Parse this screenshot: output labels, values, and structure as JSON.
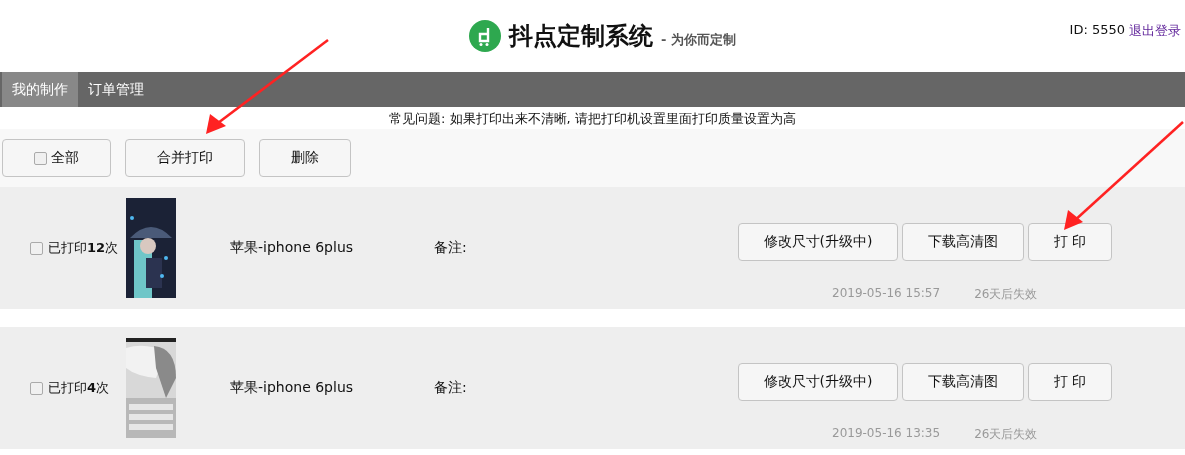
{
  "header": {
    "title": "抖点定制系统",
    "slogan": "- 为你而定制",
    "user_id": "ID: 5550",
    "logout": "退出登录"
  },
  "nav": [
    {
      "label": "我的制作",
      "selected": true
    },
    {
      "label": "订单管理",
      "selected": false
    }
  ],
  "notice": "常见问题: 如果打印出来不清晰, 请把打印机设置里面打印质量设置为高",
  "toolbar": {
    "select_all": {
      "label": "全部",
      "checked": false
    },
    "buttons": [
      "合并打印",
      "删除"
    ]
  },
  "orders": [
    {
      "checked": false,
      "printed": "已打印**12**次",
      "model": "苹果-iphone 6plus",
      "note": "备注:",
      "buttons": [
        "修改尺寸(升级中)",
        "下载高清图",
        "打 印"
      ],
      "date": "2019-05-16 15:57",
      "expiry": "26天后失效"
    },
    {
      "checked": false,
      "printed": "已打印**4**次",
      "model": "苹果-iphone 6plus",
      "note": "备注:",
      "buttons": [
        "修改尺寸(升级中)",
        "下载高清图",
        "打 印"
      ],
      "date": "2019-05-16 13:35",
      "expiry": "26天后失效"
    }
  ]
}
